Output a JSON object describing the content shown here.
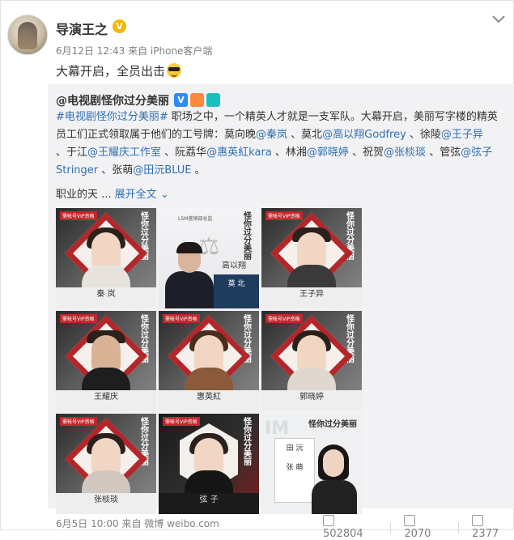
{
  "post": {
    "author": "导演王之",
    "verified_mark": "V",
    "meta": "6月12日 12:43 来自 iPhone客户端",
    "text": "大幕开启，全员出击",
    "emoji": "sunglasses-emoji"
  },
  "repost": {
    "author": "@电视剧怪你过分美丽",
    "badge_v": "V",
    "text_line1_parts": [
      {
        "t": "#电视剧怪你过分美丽#",
        "c": "lnk2"
      },
      {
        "t": " 职场之中，一个精英人才就是一支军队。大幕开启，美丽写字楼的精英",
        "c": ""
      }
    ],
    "text_line2_parts": [
      {
        "t": "员工们正式领取属于他们的工号牌：莫向晚",
        "c": ""
      },
      {
        "t": "@秦岚",
        "c": "lnk2"
      },
      {
        "t": " 、莫北",
        "c": ""
      },
      {
        "t": "@高以翔Godfrey",
        "c": "lnk2"
      },
      {
        "t": " 、徐陵",
        "c": ""
      },
      {
        "t": "@王子异",
        "c": "lnk2"
      }
    ],
    "text_line3_parts": [
      {
        "t": "、于江",
        "c": ""
      },
      {
        "t": "@王耀庆工作室",
        "c": "lnk2"
      },
      {
        "t": " 、阮荔华",
        "c": ""
      },
      {
        "t": "@惠英紅kara",
        "c": "lnk2"
      },
      {
        "t": " 、林湘",
        "c": ""
      },
      {
        "t": "@郭晓婷",
        "c": "lnk2"
      },
      {
        "t": " 、祝贺",
        "c": ""
      },
      {
        "t": "@张棪琰",
        "c": "lnk2"
      },
      {
        "t": " 、管弦",
        "c": ""
      },
      {
        "t": "@弦子",
        "c": "lnk2"
      }
    ],
    "text_line4_parts": [
      {
        "t": "Stringer",
        "c": "lnk2"
      },
      {
        "t": " 、张萌",
        "c": ""
      },
      {
        "t": "@田沅BLUE",
        "c": "lnk2"
      },
      {
        "t": " 。",
        "c": ""
      }
    ],
    "expand_prefix": "职业的天 ...",
    "expand_label": "展开全文",
    "tiles": [
      {
        "name": "秦 岚"
      },
      {
        "name": "高以翔",
        "nav_title": "莫 北",
        "top": "LSM营销部总监"
      },
      {
        "name": "王子异"
      },
      {
        "name": "王耀庆"
      },
      {
        "name": "惠英紅"
      },
      {
        "name": "郭晓婷"
      },
      {
        "name": "张棪琰"
      },
      {
        "name": "弦 子"
      },
      {
        "name_left1": "田 沅",
        "name_left2": "张 萌"
      }
    ],
    "tile_vip": "需帐号VIP资格",
    "tile_logo": "怪你过分美丽",
    "meta": "6月5日 10:00 来自 微博 weibo.com",
    "reposts": "502804",
    "comments": "2070",
    "likes": "2377"
  },
  "colors": {
    "link": "#2f6fb0",
    "accent_red": "#b3262a",
    "verified": "#f7b500"
  }
}
